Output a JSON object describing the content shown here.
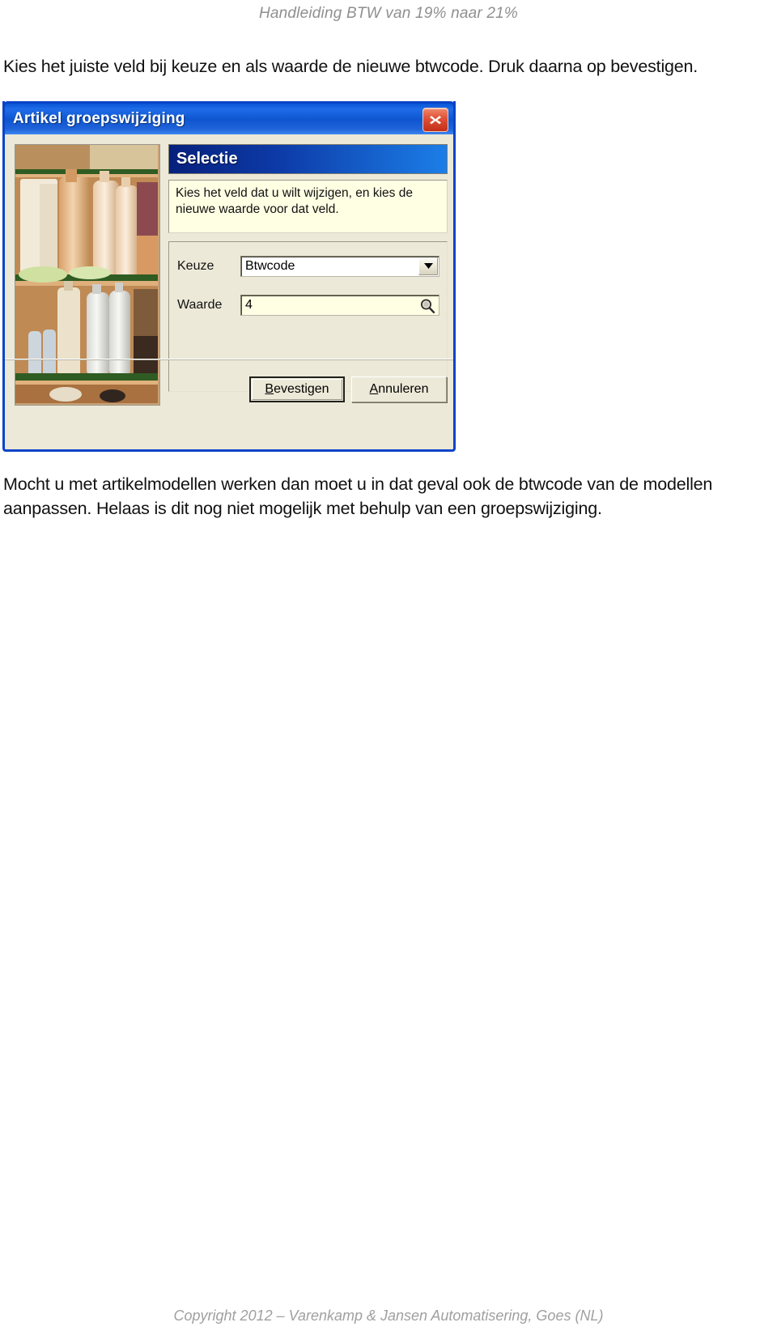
{
  "page": {
    "header": "Handleiding BTW van 19% naar 21%",
    "intro_text": "Kies het juiste veld bij keuze en als waarde de nieuwe btwcode. Druk daarna op bevestigen.",
    "closing_text": "Mocht u met artikelmodellen werken dan moet u in dat geval ook de btwcode van de modellen aanpassen. Helaas is dit nog niet mogelijk met behulp van een groepswijziging.",
    "footer": "Copyright 2012 – Varenkamp & Jansen Automatisering, Goes (NL)"
  },
  "dialog": {
    "title": "Artikel groepswijziging",
    "close_icon": "close-x-icon",
    "section": {
      "header": "Selectie",
      "description": "Kies het veld dat u wilt wijzigen, en kies de nieuwe waarde voor dat veld."
    },
    "fields": {
      "keuze": {
        "label": "Keuze",
        "value": "Btwcode",
        "control": "dropdown",
        "arrow_icon": "chevron-down-icon"
      },
      "waarde": {
        "label": "Waarde",
        "value": "4",
        "control": "text-with-lookup",
        "lookup_icon": "magnifier-icon"
      }
    },
    "buttons": {
      "confirm": {
        "label": "Bevestigen",
        "accel": "B",
        "is_default": true
      },
      "cancel": {
        "label": "Annuleren",
        "accel": "A",
        "is_default": false
      }
    },
    "illustration": {
      "alt": "shelves-with-bottles-photo"
    },
    "colors": {
      "titlebar_blue": "#0f55d0",
      "border_blue": "#0a44c8",
      "close_red": "#c22f16",
      "face": "#ece9d8",
      "field_cream": "#ffffe4",
      "section_dark": "#06207c",
      "section_light": "#1c7ee8"
    }
  }
}
